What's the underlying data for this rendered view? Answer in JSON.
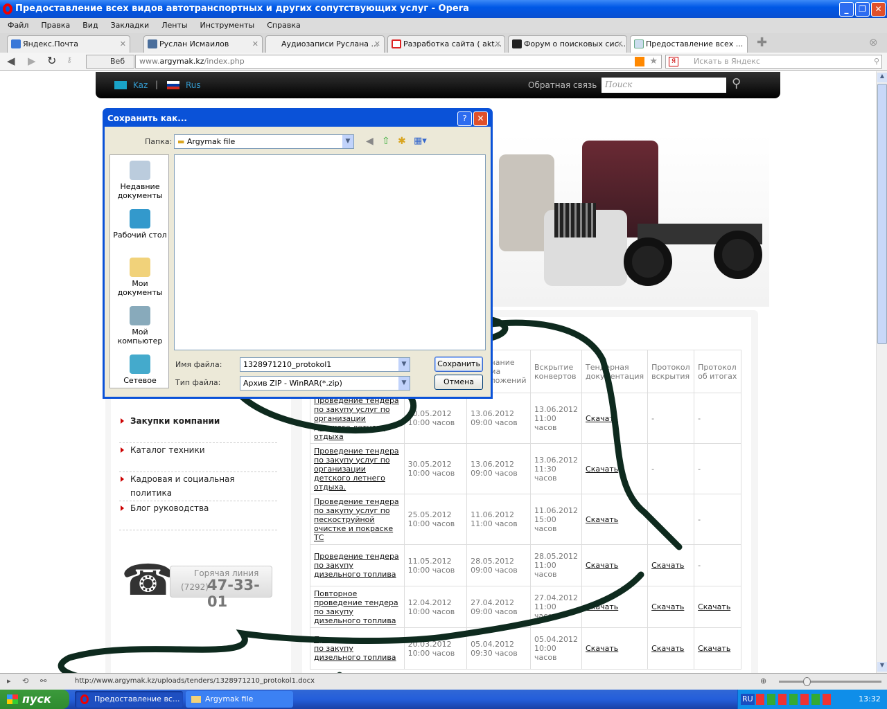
{
  "window": {
    "title": "Предоставление всех видов автотранспортных и других сопутствующих услуг - Opera"
  },
  "menu": [
    "Файл",
    "Правка",
    "Вид",
    "Закладки",
    "Ленты",
    "Инструменты",
    "Справка"
  ],
  "tabs": [
    {
      "label": "Яндекс.Почта",
      "color": "#3a78d8"
    },
    {
      "label": "Руслан Исмаилов",
      "color": "#4a6e9c"
    },
    {
      "label": "Аудиозаписи Руслана ...",
      "color": "#f0f0f0"
    },
    {
      "label": "Разработка сайта ( akt...",
      "color": "#d22"
    },
    {
      "label": "Форум о поисковых сис...",
      "color": "#222"
    },
    {
      "label": "Предоставление всех ...",
      "color": "#6a8"
    }
  ],
  "address": {
    "web_label": "Веб",
    "url_prefix": "www.",
    "url_domain": "argymak.kz",
    "url_path": "/index.php",
    "search_placeholder": "Искать в Яндекс"
  },
  "site": {
    "lang_kaz": "Kaz",
    "lang_rus": "Rus",
    "feedback": "Обратная связь",
    "search_placeholder": "Поиск",
    "menu": [
      "Закупки компании",
      "Каталог техники",
      "Кадровая и социальная политика",
      "Блог руководства"
    ],
    "hotline_label": "Горячая линия",
    "hotline_code": "(7292)",
    "hotline_number": "47-33-01"
  },
  "table": {
    "headers": [
      "",
      "",
      "Окончание приема предложений",
      "Вскрытие конвертов",
      "Тендерная документация",
      "Протокол вскрытия",
      "Протокол об итогах"
    ],
    "rows": [
      [
        "Проведение тендера по закупу услуг по организации детского летнего отдыха",
        "30.05.2012 10:00 часов",
        "13.06.2012 09:00 часов",
        "13.06.2012 11:00 часов",
        "Скачать",
        "-",
        "-"
      ],
      [
        "Проведение тендера по закупу услуг по организации детского летнего отдыха.",
        "30.05.2012 10:00 часов",
        "13.06.2012 09:00 часов",
        "13.06.2012 11:30 часов",
        "Скачать",
        "-",
        "-"
      ],
      [
        "Проведение тендера по закупу услуг по пескоструйной очистке и покраске ТС",
        "25.05.2012 10:00 часов",
        "11.06.2012 11:00 часов",
        "11.06.2012 15:00 часов",
        "Скачать",
        "-",
        "-"
      ],
      [
        "Проведение тендера по закупу дизельного топлива",
        "11.05.2012 10:00 часов",
        "28.05.2012 09:00 часов",
        "28.05.2012 11:00 часов",
        "Скачать",
        "Скачать",
        "-"
      ],
      [
        "Повторное проведение тендера по закупу дизельного топлива",
        "12.04.2012 10:00 часов",
        "27.04.2012 09:00 часов",
        "27.04.2012 11:00 часов",
        "Скачать",
        "Скачать",
        "Скачать"
      ],
      [
        "Проведение тендера по закупу дизельного топлива",
        "20.03.2012 10:00 часов",
        "05.04.2012 09:30 часов",
        "05.04.2012 10:00 часов",
        "Скачать",
        "Скачать",
        "Скачать"
      ]
    ]
  },
  "dialog": {
    "title": "Сохранить как...",
    "folder_label": "Папка:",
    "folder_value": "Argymak file",
    "places": [
      "Недавние документы",
      "Рабочий стол",
      "Мои документы",
      "Мой компьютер",
      "Сетевое"
    ],
    "filename_label": "Имя файла:",
    "filename_value": "1328971210_protokol1",
    "filetype_label": "Тип файла:",
    "filetype_value": "Архив ZIP - WinRAR(*.zip)",
    "save": "Сохранить",
    "cancel": "Отмена",
    "help": "?",
    "close": "✕"
  },
  "status": {
    "url": "http://www.argymak.kz/uploads/tenders/1328971210_protokol1.docx",
    "zoom_percent": 100
  },
  "taskbar": {
    "start": "пуск",
    "tasks": [
      "Предоставление вс...",
      "Argymak file"
    ],
    "lang": "RU",
    "clock": "13:32"
  }
}
